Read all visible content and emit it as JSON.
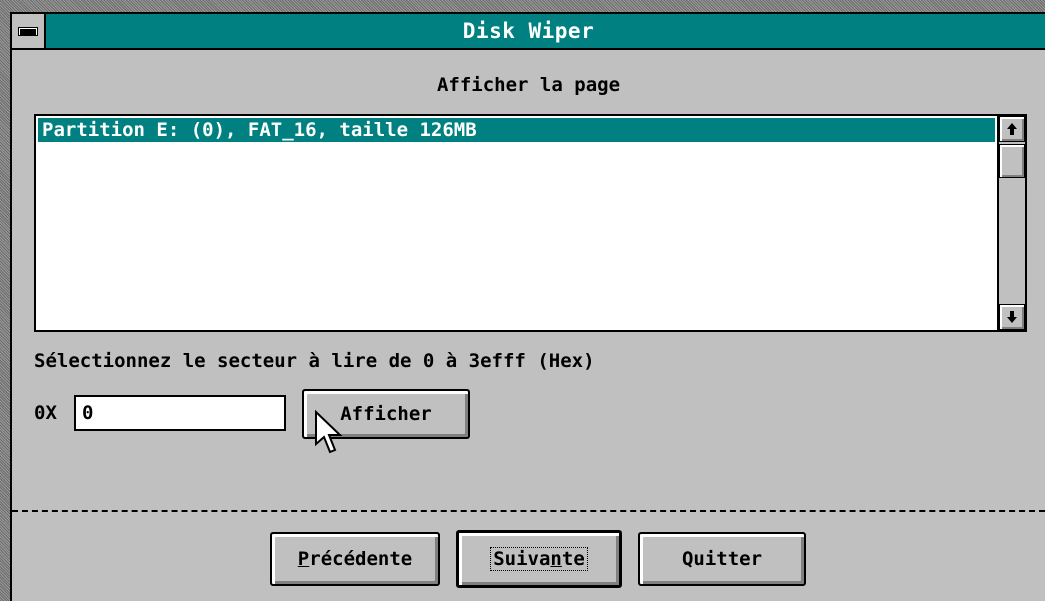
{
  "window": {
    "title": "Disk Wiper",
    "system_menu_icon": "minus-icon"
  },
  "page_heading": "Afficher la page",
  "partition_list": {
    "items": [
      "Partition E: (0), FAT_16, taille 126MB"
    ],
    "selected_index": 0,
    "scroll_up_icon": "arrow-up-icon",
    "scroll_down_icon": "arrow-down-icon"
  },
  "sector": {
    "label": "Sélectionnez le secteur à lire de 0 à 3efff (Hex)",
    "prefix": "0X",
    "value": "0",
    "afficher_label": "Afficher"
  },
  "footer": {
    "prev_label": "Précédente",
    "next_label": "Suivante",
    "quit_label": "Quitter"
  },
  "colors": {
    "titlebar": "#008080",
    "selection": "#008080",
    "face": "#c0c0c0"
  }
}
